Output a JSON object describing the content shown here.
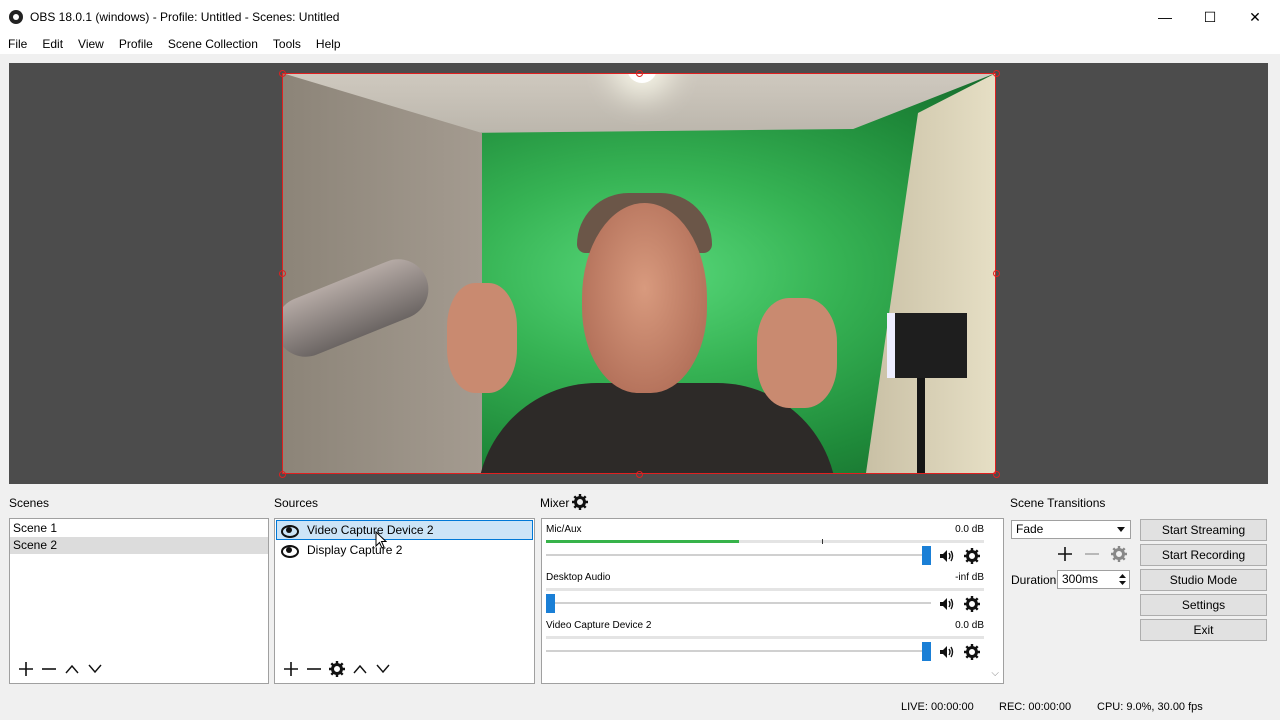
{
  "window": {
    "title": "OBS 18.0.1 (windows) - Profile: Untitled - Scenes: Untitled",
    "minimize": "—",
    "maximize": "☐",
    "close": "✕"
  },
  "menu": [
    "File",
    "Edit",
    "View",
    "Profile",
    "Scene Collection",
    "Tools",
    "Help"
  ],
  "scenes": {
    "label": "Scenes",
    "items": [
      {
        "name": "Scene 1",
        "selected": false
      },
      {
        "name": "Scene 2",
        "selected": true
      }
    ],
    "toolbar_icons": [
      "plus-icon",
      "minus-icon",
      "chevron-up-icon",
      "chevron-down-icon"
    ]
  },
  "sources": {
    "label": "Sources",
    "items": [
      {
        "name": "Video Capture Device 2",
        "selected": true
      },
      {
        "name": "Display Capture 2",
        "selected": false
      }
    ],
    "toolbar_icons": [
      "plus-icon",
      "minus-icon",
      "gear-icon",
      "chevron-up-icon",
      "chevron-down-icon"
    ]
  },
  "mixer": {
    "label": "Mixer",
    "channels": [
      {
        "name": "Mic/Aux",
        "db": "0.0 dB",
        "level": 0.44,
        "volume": 1.0
      },
      {
        "name": "Desktop Audio",
        "db": "-inf dB",
        "level": 0.0,
        "volume": 0.0
      },
      {
        "name": "Video Capture Device 2",
        "db": "0.0 dB",
        "level": 0.0,
        "volume": 1.0
      }
    ]
  },
  "transitions": {
    "label": "Scene Transitions",
    "selected": "Fade",
    "duration_label": "Duration",
    "duration_value": "300ms"
  },
  "controls": {
    "start_streaming": "Start Streaming",
    "start_recording": "Start Recording",
    "studio_mode": "Studio Mode",
    "settings": "Settings",
    "exit": "Exit"
  },
  "status": {
    "live": "LIVE: 00:00:00",
    "rec": "REC: 00:00:00",
    "cpu": "CPU: 9.0%, 30.00 fps"
  },
  "colors": {
    "accent": "#1a7fd6",
    "meter": "#37b34a",
    "selection_border": "#e02020"
  }
}
